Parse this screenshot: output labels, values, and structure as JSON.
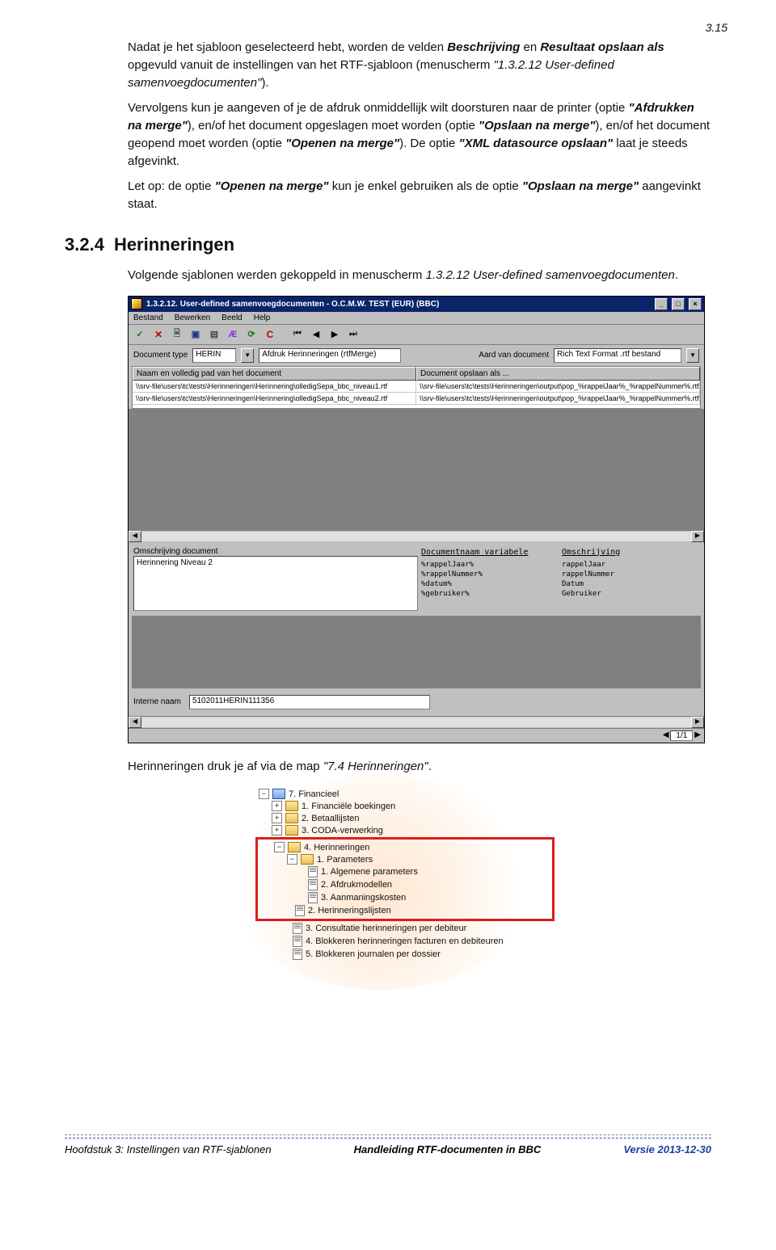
{
  "pageNumber": "3.15",
  "intro": {
    "p1_a": "Nadat je het sjabloon geselecteerd hebt, worden de velden ",
    "p1_b1": "Beschrijving",
    "p1_c": " en ",
    "p1_b2": "Resultaat opslaan als",
    "p1_d": " opgevuld vanuit de instellingen van het RTF-sjabloon (menuscherm ",
    "p1_i": "\"1.3.2.12 User-defined samenvoegdocumenten\"",
    "p1_e": ").",
    "p2_a": "Vervolgens kun je aangeven of je de afdruk onmiddellijk wilt doorsturen naar de printer (optie ",
    "p2_b1": "\"Afdrukken na merge\"",
    "p2_c": "), en/of het document opgeslagen moet worden (optie ",
    "p2_b2": "\"Opslaan na merge\"",
    "p2_d": "), en/of het document geopend moet worden (optie ",
    "p2_b3": "\"Openen na merge\"",
    "p2_e": "). De optie ",
    "p2_b4": "\"XML datasource opslaan\"",
    "p2_f": " laat je steeds afgevinkt.",
    "p3_a": "Let op: de optie ",
    "p3_b1": "\"Openen na merge\"",
    "p3_c": " kun je enkel gebruiken als de optie ",
    "p3_b2": "\"Opslaan na merge\"",
    "p3_d": " aangevinkt staat."
  },
  "section": {
    "nr": "3.2.4",
    "title": "Herinneringen"
  },
  "afterHeading": {
    "a": "Volgende sjablonen werden gekoppeld in menuscherm ",
    "i": "1.3.2.12 User-defined samenvoegdocumenten",
    "b": "."
  },
  "app": {
    "title": "1.3.2.12. User-defined samenvoegdocumenten - O.C.M.W. TEST (EUR) (BBC)",
    "menu": [
      "Bestand",
      "Bewerken",
      "Beeld",
      "Help"
    ],
    "toolbarIcons": [
      "check",
      "x",
      "page-new",
      "page-blue",
      "page-arrow",
      "refresh-a",
      "refresh-green",
      "c-red",
      "nav-first",
      "nav-prev",
      "nav-next",
      "nav-last"
    ],
    "docTypeLabel": "Document type",
    "docTypeCode": "HERIN",
    "docTypeDesc": "Afdruk Herinneringen (rtfMerge)",
    "aardLabel": "Aard van document",
    "aardValue": "Rich Text Format .rtf bestand",
    "grid": {
      "col1": "Naam en volledig pad van het document",
      "col2": "Document opslaan als ...",
      "rows": [
        {
          "c1": "\\\\srv-file\\users\\tc\\tests\\Herinneringen\\Herinnering\\olledigSepa_bbc_niveau1.rtf",
          "c2": "\\\\srv-file\\users\\tc\\tests\\Herinneringen\\output\\pop_%rappelJaar%_%rappelNummer%.rtf"
        },
        {
          "c1": "\\\\srv-file\\users\\tc\\tests\\Herinneringen\\Herinnering\\olledigSepa_bbc_niveau2.rtf",
          "c2": "\\\\srv-file\\users\\tc\\tests\\Herinneringen\\output\\pop_%rappelJaar%_%rappelNummer%.rtf"
        }
      ]
    },
    "below": {
      "omschrLabel": "Omschrijving document",
      "omschrValue": "Herinnering Niveau 2",
      "varHead": "Documentnaam variabele",
      "omsHead": "Omschrijving",
      "vars": [
        {
          "v": "%rappelJaar%",
          "o": "rappelJaar"
        },
        {
          "v": "%rappelNummer%",
          "o": "rappelNummer"
        },
        {
          "v": "%datum%",
          "o": "Datum"
        },
        {
          "v": "%gebruiker%",
          "o": "Gebruiker"
        }
      ]
    },
    "internalLabel": "Interne naam",
    "internalValue": "5102011HERIN111356",
    "pager": "1/1"
  },
  "afterApp": {
    "a": "Herinneringen druk je af via de map ",
    "i": "\"7.4 Herinneringen\"",
    "b": "."
  },
  "tree": {
    "n0": "7. Financieel",
    "n1": "1. Financiële boekingen",
    "n2": "2. Betaallijsten",
    "n3": "3. CODA-verwerking",
    "n4": "4. Herinneringen",
    "n41": "1. Parameters",
    "n411": "1. Algemene parameters",
    "n412": "2. Afdrukmodellen",
    "n413": "3. Aanmaningskosten",
    "n42": "2. Herinneringslijsten",
    "n43": "3. Consultatie herinneringen per debiteur",
    "n44": "4. Blokkeren herinneringen facturen en debiteuren",
    "n45": "5. Blokkeren journalen per dossier"
  },
  "footer": {
    "left": "Hoofdstuk 3: Instellingen van RTF-sjablonen",
    "mid": "Handleiding RTF-documenten in BBC",
    "right": "Versie 2013-12-30"
  }
}
